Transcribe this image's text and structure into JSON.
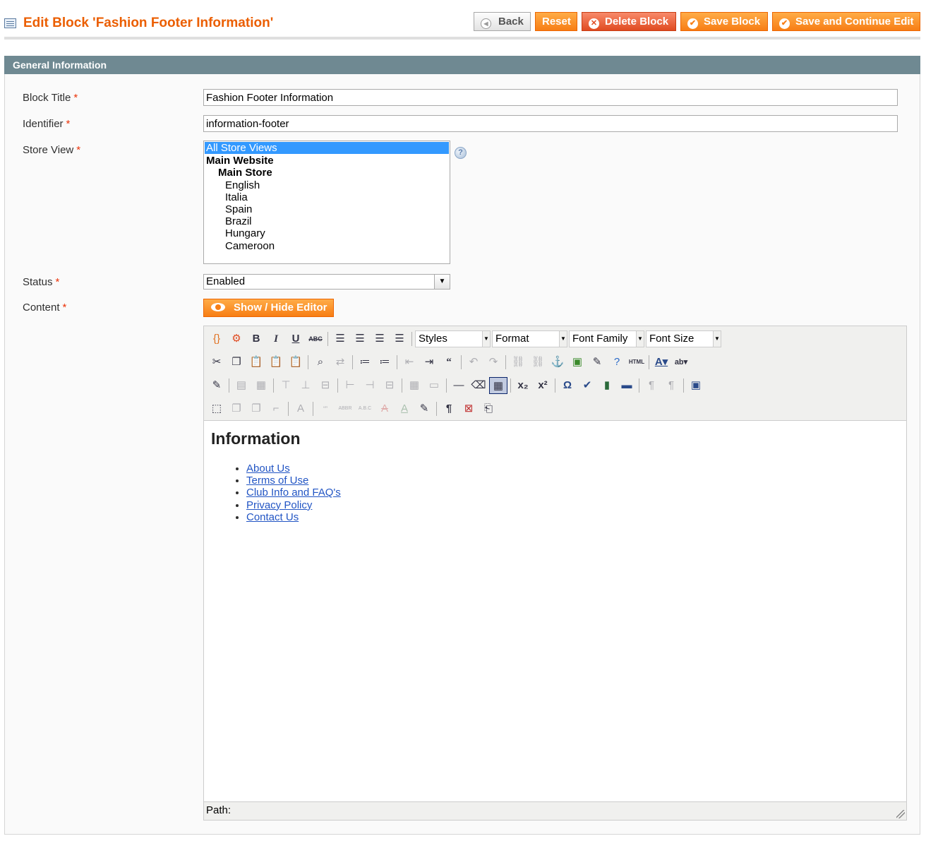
{
  "header": {
    "title": "Edit Block 'Fashion Footer Information'",
    "buttons": {
      "back": "Back",
      "reset": "Reset",
      "delete": "Delete Block",
      "save": "Save Block",
      "save_continue": "Save and Continue Edit"
    }
  },
  "section": {
    "title": "General Information"
  },
  "form": {
    "block_title": {
      "label": "Block Title",
      "value": "Fashion Footer Information"
    },
    "identifier": {
      "label": "Identifier",
      "value": "information-footer"
    },
    "store_view": {
      "label": "Store View",
      "options": [
        {
          "text": "All Store Views",
          "selected": true
        },
        {
          "text": "Main Website",
          "group": true
        },
        {
          "text": "Main Store",
          "group": true
        },
        {
          "text": "English"
        },
        {
          "text": "Italia"
        },
        {
          "text": "Spain"
        },
        {
          "text": "Brazil"
        },
        {
          "text": "Hungary"
        },
        {
          "text": "Cameroon"
        }
      ]
    },
    "status": {
      "label": "Status",
      "value": "Enabled"
    },
    "content": {
      "label": "Content",
      "toggle_button": "Show / Hide Editor"
    },
    "required_mark": "*"
  },
  "editor": {
    "selects": {
      "styles": "Styles",
      "format": "Format",
      "font_family": "Font Family",
      "font_size": "Font Size"
    },
    "body": {
      "heading": "Information",
      "links": [
        "About Us",
        "Terms of Use",
        "Club Info and FAQ's",
        "Privacy Policy",
        "Contact Us"
      ]
    },
    "path_label": "Path:"
  },
  "colors": {
    "accent": "#eb5e00",
    "section_header": "#6f8992",
    "link": "#2255c4",
    "selection": "#3399ff"
  }
}
